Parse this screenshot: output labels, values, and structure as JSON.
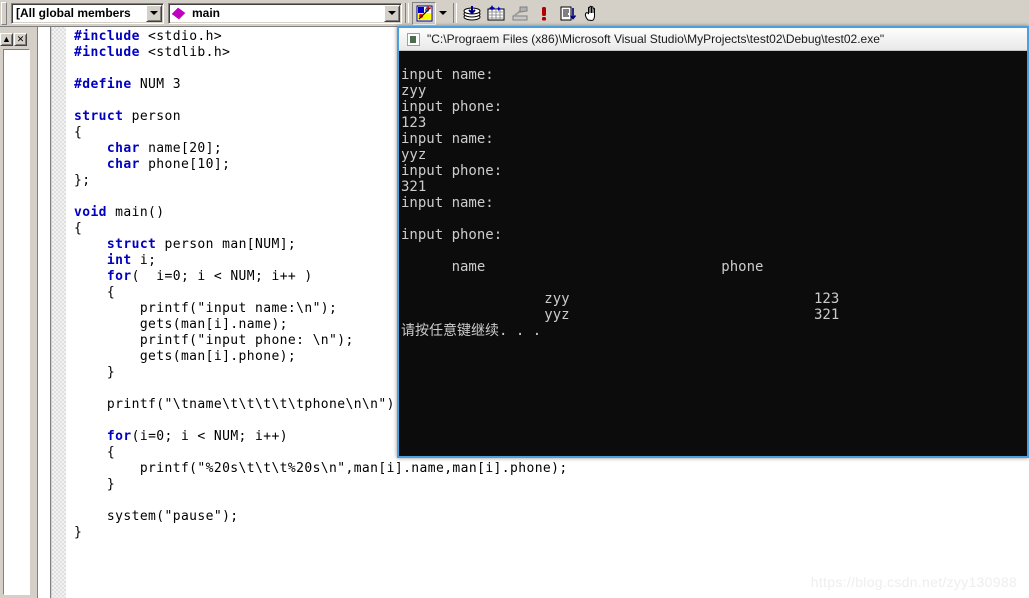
{
  "toolbar": {
    "members_combo": {
      "value": "[All global members",
      "icon": "chevron-down-icon"
    },
    "function_combo": {
      "value": "main",
      "icon": "diamond-member-icon",
      "dropdown_icon": "chevron-down-icon"
    },
    "buttons": [
      {
        "name": "resource-view-button",
        "icon": "palette-icon",
        "pressed": true
      },
      {
        "name": "resource-view-dropdown",
        "icon": "chevron-down-icon",
        "pressed": false
      },
      {
        "name": "compile-button",
        "icon": "compile-stack-icon",
        "pressed": false
      },
      {
        "name": "build-button",
        "icon": "build-grid-icon",
        "pressed": false
      },
      {
        "name": "stop-build-button",
        "icon": "hammer-disabled-icon",
        "pressed": false
      },
      {
        "name": "execute-program-button",
        "icon": "exclamation-red-icon",
        "pressed": false
      },
      {
        "name": "go-button",
        "icon": "document-arrow-down-icon",
        "pressed": false
      },
      {
        "name": "insert-breakpoint-button",
        "icon": "hand-icon",
        "pressed": false
      }
    ]
  },
  "left_panel": {
    "restore_button_label": "▲",
    "close_button_label": "✕"
  },
  "editor": {
    "lines": [
      [
        {
          "t": "#include",
          "c": "pp"
        },
        {
          "t": " <stdio.h>",
          "c": "pl"
        }
      ],
      [
        {
          "t": "#include",
          "c": "pp"
        },
        {
          "t": " <stdlib.h>",
          "c": "pl"
        }
      ],
      [],
      [
        {
          "t": "#define",
          "c": "pp"
        },
        {
          "t": " NUM 3",
          "c": "pl"
        }
      ],
      [],
      [
        {
          "t": "struct",
          "c": "kw"
        },
        {
          "t": " person",
          "c": "pl"
        }
      ],
      [
        {
          "t": "{",
          "c": "pl"
        }
      ],
      [
        {
          "t": "    ",
          "c": "pl"
        },
        {
          "t": "char",
          "c": "kw"
        },
        {
          "t": " name[20];",
          "c": "pl"
        }
      ],
      [
        {
          "t": "    ",
          "c": "pl"
        },
        {
          "t": "char",
          "c": "kw"
        },
        {
          "t": " phone[10];",
          "c": "pl"
        }
      ],
      [
        {
          "t": "};",
          "c": "pl"
        }
      ],
      [],
      [
        {
          "t": "void",
          "c": "kw"
        },
        {
          "t": " main()",
          "c": "pl"
        }
      ],
      [
        {
          "t": "{",
          "c": "pl"
        }
      ],
      [
        {
          "t": "    ",
          "c": "pl"
        },
        {
          "t": "struct",
          "c": "kw"
        },
        {
          "t": " person man[NUM];",
          "c": "pl"
        }
      ],
      [
        {
          "t": "    ",
          "c": "pl"
        },
        {
          "t": "int",
          "c": "kw"
        },
        {
          "t": " i;",
          "c": "pl"
        }
      ],
      [
        {
          "t": "    ",
          "c": "pl"
        },
        {
          "t": "for",
          "c": "kw"
        },
        {
          "t": "(  i=0; i < NUM; i++ )",
          "c": "pl"
        }
      ],
      [
        {
          "t": "    {",
          "c": "pl"
        }
      ],
      [
        {
          "t": "        printf(\"input name:\\n\");",
          "c": "pl"
        }
      ],
      [
        {
          "t": "        gets(man[i].name);",
          "c": "pl"
        }
      ],
      [
        {
          "t": "        printf(\"input phone: \\n\");",
          "c": "pl"
        }
      ],
      [
        {
          "t": "        gets(man[i].phone);",
          "c": "pl"
        }
      ],
      [
        {
          "t": "    }",
          "c": "pl"
        }
      ],
      [],
      [
        {
          "t": "    printf(\"\\tname\\t\\t\\t\\t\\tphone\\n\\n\");",
          "c": "pl"
        }
      ],
      [],
      [
        {
          "t": "    ",
          "c": "pl"
        },
        {
          "t": "for",
          "c": "kw"
        },
        {
          "t": "(i=0; i < NUM; i++)",
          "c": "pl"
        }
      ],
      [
        {
          "t": "    {",
          "c": "pl"
        }
      ],
      [
        {
          "t": "        printf(\"%20s\\t\\t\\t%20s\\n\",man[i].name,man[i].phone);",
          "c": "pl"
        }
      ],
      [
        {
          "t": "    }",
          "c": "pl"
        }
      ],
      [],
      [
        {
          "t": "    system(\"pause\");",
          "c": "pl"
        }
      ],
      [
        {
          "t": "}",
          "c": "pl"
        }
      ]
    ]
  },
  "console": {
    "title": "\"C:\\Prograem Files (x86)\\Microsoft Visual Studio\\MyProjects\\test02\\Debug\\test02.exe\"",
    "icon": "console-window-icon",
    "output": "input name:\nzyy\ninput phone:\n123\ninput name:\nyyz\ninput phone:\n321\ninput name:\n\ninput phone:\n\n      name                            phone\n\n                 zyy                             123\n                 yyz                             321\n请按任意键继续. . .\n"
  },
  "watermark": {
    "text": "https://blog.csdn.net/zyy130988"
  },
  "colors": {
    "toolbar_bg": "#d4d0c8",
    "keyword": "#0000c0",
    "console_bg": "#0c0c0c",
    "console_fg": "#cccccc",
    "console_border": "#4a9fdc",
    "accent_magenta": "#c000c0"
  }
}
